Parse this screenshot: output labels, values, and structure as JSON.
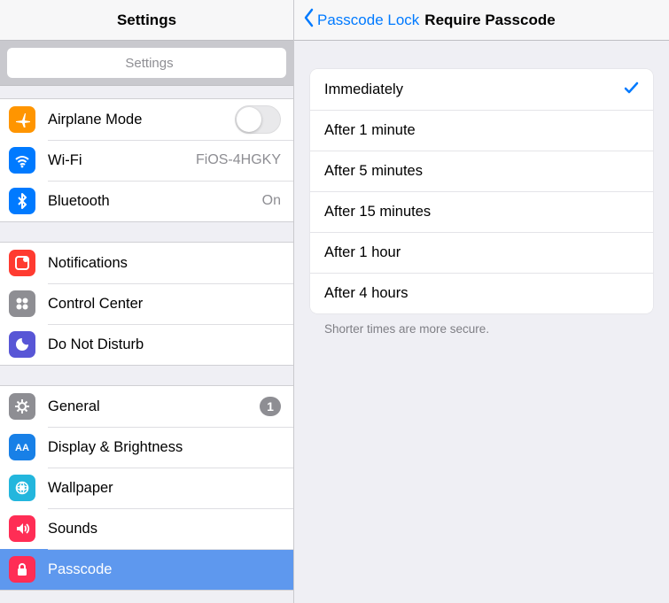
{
  "sidebar": {
    "title": "Settings",
    "search_placeholder": "Settings",
    "groups": [
      {
        "rows": [
          {
            "icon": "airplane",
            "label": "Airplane Mode",
            "accessory": "switch",
            "switch_on": false
          },
          {
            "icon": "wifi",
            "label": "Wi-Fi",
            "accessory": "detail",
            "detail": "FiOS-4HGKY"
          },
          {
            "icon": "bluetooth",
            "label": "Bluetooth",
            "accessory": "detail",
            "detail": "On"
          }
        ]
      },
      {
        "rows": [
          {
            "icon": "notifications",
            "label": "Notifications"
          },
          {
            "icon": "control-center",
            "label": "Control Center"
          },
          {
            "icon": "dnd",
            "label": "Do Not Disturb"
          }
        ]
      },
      {
        "rows": [
          {
            "icon": "general",
            "label": "General",
            "accessory": "badge",
            "badge": "1"
          },
          {
            "icon": "display",
            "label": "Display & Brightness"
          },
          {
            "icon": "wallpaper",
            "label": "Wallpaper"
          },
          {
            "icon": "sounds",
            "label": "Sounds"
          },
          {
            "icon": "passcode",
            "label": "Passcode",
            "selected": true
          }
        ]
      }
    ]
  },
  "main": {
    "back_label": "Passcode Lock",
    "title": "Require Passcode",
    "options": [
      {
        "label": "Immediately",
        "selected": true
      },
      {
        "label": "After 1 minute",
        "selected": false
      },
      {
        "label": "After 5 minutes",
        "selected": false
      },
      {
        "label": "After 15 minutes",
        "selected": false
      },
      {
        "label": "After 1 hour",
        "selected": false
      },
      {
        "label": "After 4 hours",
        "selected": false
      }
    ],
    "footer": "Shorter times are more secure."
  },
  "icon_meta": {
    "airplane": {
      "bg": "bg-orange"
    },
    "wifi": {
      "bg": "bg-blue"
    },
    "bluetooth": {
      "bg": "bg-blue"
    },
    "notifications": {
      "bg": "bg-red"
    },
    "control-center": {
      "bg": "bg-gray"
    },
    "dnd": {
      "bg": "bg-purple"
    },
    "general": {
      "bg": "bg-gray"
    },
    "display": {
      "bg": "bg-bluea"
    },
    "wallpaper": {
      "bg": "bg-cyan"
    },
    "sounds": {
      "bg": "bg-pink"
    },
    "passcode": {
      "bg": "bg-pink"
    }
  }
}
